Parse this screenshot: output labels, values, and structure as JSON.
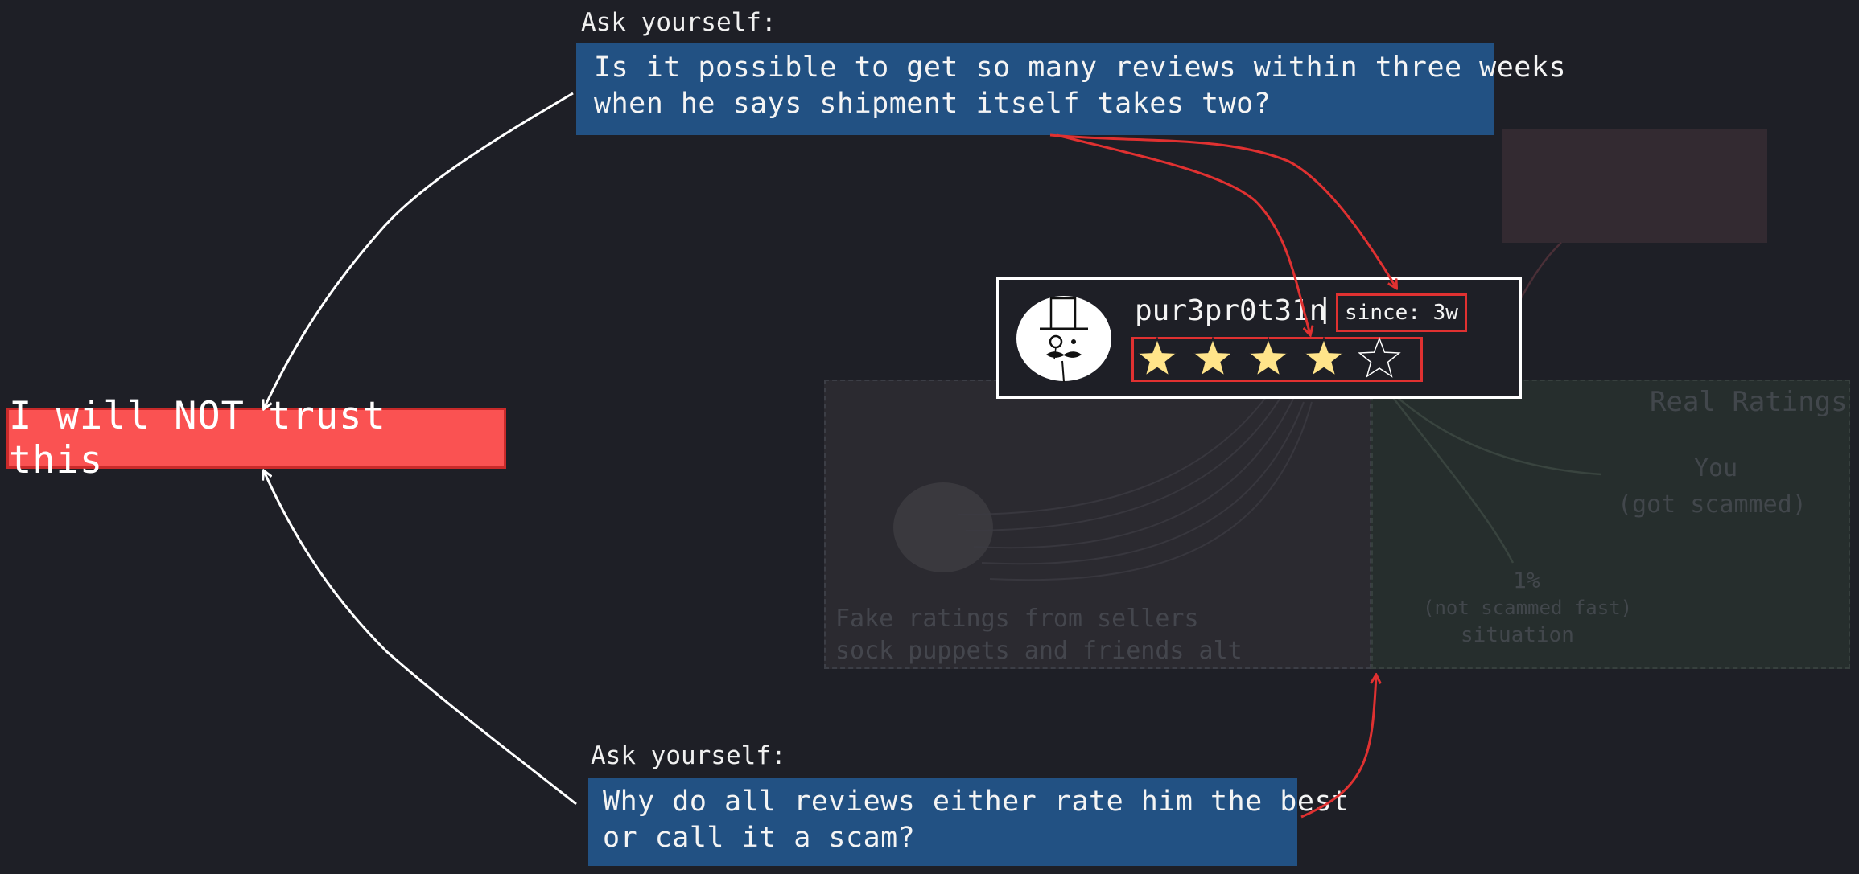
{
  "top_question": {
    "label": "Ask yourself:",
    "lines": [
      "Is it possible to get so many reviews within three weeks",
      "when he says shipment itself takes two?"
    ]
  },
  "bottom_question": {
    "label": "Ask yourself:",
    "lines": [
      "Why do all reviews either rate him the best",
      "or call it a scam?"
    ]
  },
  "verdict": {
    "text": "I will NOT trust this"
  },
  "profile": {
    "username": "pur3pr0t31n",
    "separator": "|",
    "since": "since: 3w",
    "rating": {
      "filled": 4,
      "total": 5
    },
    "avatar_icon": "top-hat-monocle-gentleman-icon"
  },
  "background": {
    "right_panel_title": "Real Ratings",
    "you_label": "You",
    "you_sub": "(got scammed)",
    "middle_label": "1%",
    "middle_sub": "(not scammed fast)",
    "middle_sub2": "situation",
    "left_caption_1": "Fake ratings from sellers",
    "left_caption_2": "sock puppets and friends alt"
  },
  "colors": {
    "background": "#1e1f26",
    "question_box": "#225183",
    "verdict_box": "#fa5252",
    "highlight_red": "#e03131",
    "star_fill": "#ffe48a",
    "white": "#ffffff"
  }
}
